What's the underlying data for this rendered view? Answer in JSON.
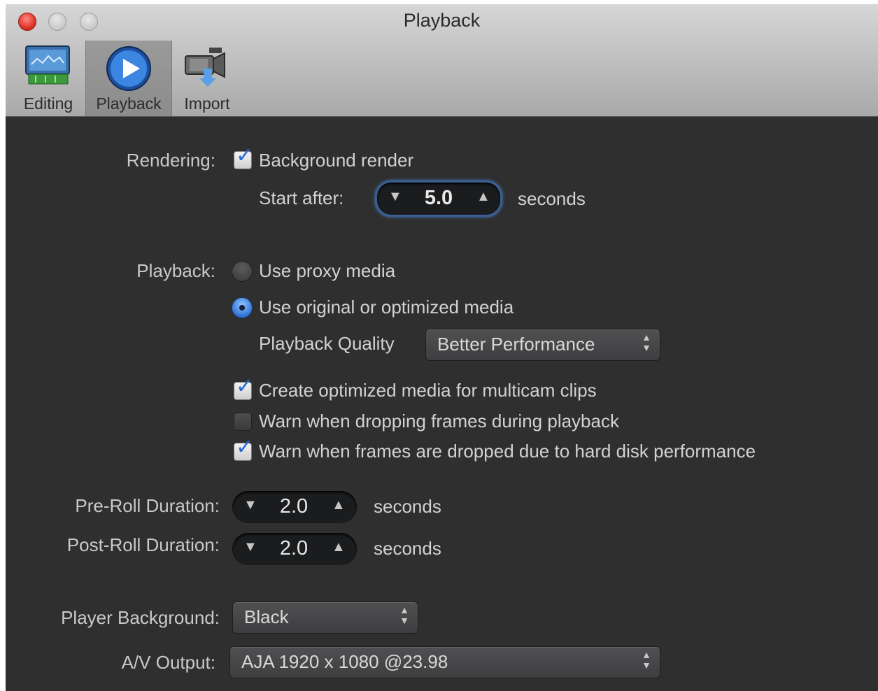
{
  "window": {
    "title": "Playback"
  },
  "toolbar": {
    "items": [
      {
        "label": "Editing",
        "icon": "editing-icon"
      },
      {
        "label": "Playback",
        "icon": "playback-icon",
        "selected": true
      },
      {
        "label": "Import",
        "icon": "import-icon"
      }
    ]
  },
  "rendering": {
    "label": "Rendering:",
    "background_render": {
      "label": "Background render",
      "checked": true
    },
    "start_after": {
      "label": "Start after:",
      "value": "5.0",
      "unit": "seconds"
    }
  },
  "playback": {
    "label": "Playback:",
    "options": [
      {
        "label": "Use proxy media",
        "selected": false
      },
      {
        "label": "Use original or optimized media",
        "selected": true
      }
    ],
    "quality": {
      "label": "Playback Quality",
      "value": "Better Performance"
    },
    "checks": [
      {
        "label": "Create optimized media for multicam clips",
        "checked": true
      },
      {
        "label": "Warn when dropping frames during playback",
        "checked": false
      },
      {
        "label": "Warn when frames are dropped due to hard disk performance",
        "checked": true
      }
    ]
  },
  "pre_roll": {
    "label": "Pre-Roll Duration:",
    "value": "2.0",
    "unit": "seconds"
  },
  "post_roll": {
    "label": "Post-Roll Duration:",
    "value": "2.0",
    "unit": "seconds"
  },
  "player_background": {
    "label": "Player Background:",
    "value": "Black"
  },
  "av_output": {
    "label": "A/V Output:",
    "value": "AJA 1920 x 1080 @23.98"
  },
  "glyphs": {
    "check": "✓",
    "down": "▼",
    "up": "▲",
    "popup_up": "▲",
    "popup_down": "▼"
  },
  "colors": {
    "accent": "#2c6fd3",
    "panel": "#2f2f30",
    "titlebar": "#c4c4c4"
  }
}
